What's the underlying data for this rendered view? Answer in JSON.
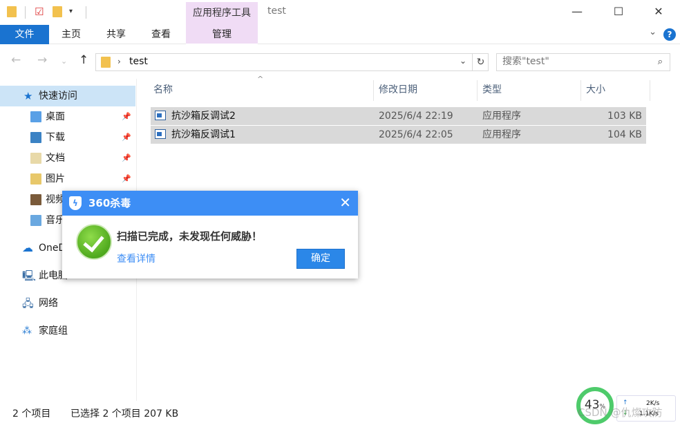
{
  "window": {
    "title": "test",
    "context_tab_group": "应用程序工具",
    "minimize": "—",
    "maximize": "☐",
    "close": "✕"
  },
  "ribbon": {
    "tabs": [
      "文件",
      "主页",
      "共享",
      "查看",
      "管理"
    ],
    "help": "?"
  },
  "address": {
    "path": "test",
    "search_placeholder": "搜索\"test\""
  },
  "sidebar": {
    "quick_access": "快速访问",
    "items": [
      {
        "label": "桌面",
        "icon": "desktop-folder-icon"
      },
      {
        "label": "下载",
        "icon": "downloads-folder-icon"
      },
      {
        "label": "文档",
        "icon": "documents-folder-icon"
      },
      {
        "label": "图片",
        "icon": "pictures-folder-icon"
      },
      {
        "label": "视频",
        "icon": "videos-folder-icon"
      },
      {
        "label": "音乐",
        "icon": "music-folder-icon"
      }
    ],
    "onedrive": "OneDrive",
    "this_pc": "此电脑",
    "network": "网络",
    "homegroup": "家庭组"
  },
  "columns": {
    "name": "名称",
    "date": "修改日期",
    "type": "类型",
    "size": "大小"
  },
  "files": [
    {
      "name": "抗沙箱反调试2",
      "date": "2025/6/4 22:19",
      "type": "应用程序",
      "size": "103 KB"
    },
    {
      "name": "抗沙箱反调试1",
      "date": "2025/6/4 22:05",
      "type": "应用程序",
      "size": "104 KB"
    }
  ],
  "status": {
    "count": "2 个项目",
    "selected": "已选择 2 个项目  207 KB"
  },
  "dialog": {
    "title": "360杀毒",
    "message": "扫描已完成，未发现任何威胁！",
    "detail_link": "查看详情",
    "ok_button": "确定"
  },
  "widgets": {
    "speed_ball_value": "43",
    "speed_ball_unit": "%",
    "upload": "2K/s",
    "download": "1.1K/s",
    "watermark": "CSDN @仇燦攻防"
  },
  "colors": {
    "accent": "#1a73d0",
    "context_tab": "#f0dcf5",
    "selection": "#d9d9d9",
    "dialog_header": "#3d8ef5",
    "success_green": "#4fa91e"
  }
}
